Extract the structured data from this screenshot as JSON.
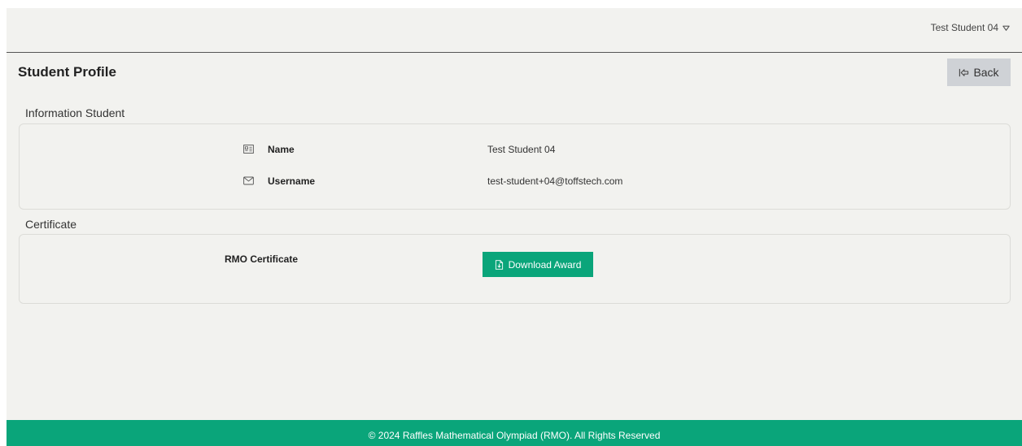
{
  "header": {
    "user_name": "Test Student 04"
  },
  "page": {
    "title": "Student Profile",
    "back_label": "Back"
  },
  "info_section": {
    "heading": "Information Student",
    "rows": [
      {
        "label": "Name",
        "value": "Test Student 04",
        "icon": "id-card-icon"
      },
      {
        "label": "Username",
        "value": "test-student+04@toffstech.com",
        "icon": "envelope-icon"
      }
    ]
  },
  "certificate_section": {
    "heading": "Certificate",
    "label": "RMO Certificate",
    "button_label": "Download Award",
    "button_icon": "document-icon"
  },
  "footer": {
    "text": "© 2024 Raffles Mathematical Olympiad (RMO). All Rights Reserved"
  },
  "colors": {
    "accent": "#0aa57a",
    "background": "#f2f2ef",
    "back_button": "#cfd2d6"
  }
}
